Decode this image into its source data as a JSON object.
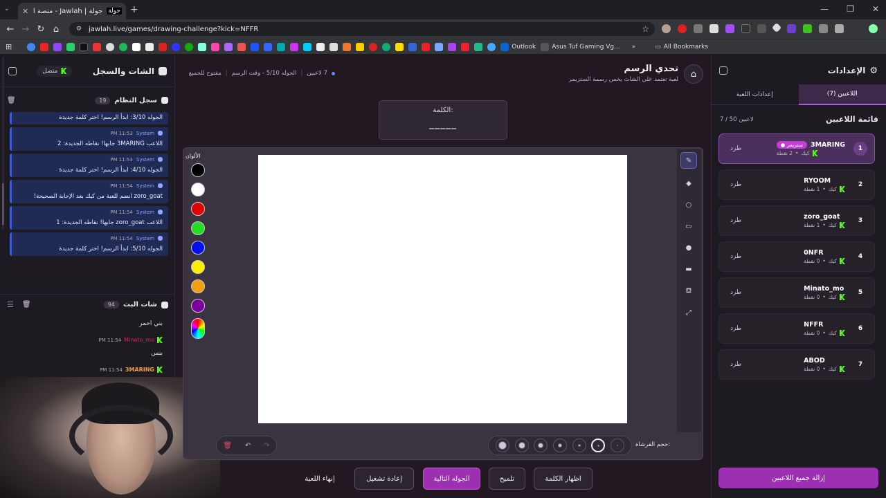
{
  "browser": {
    "tab_title": "جولة | Jawlah - منصة الألعاب ال...",
    "url": "jawlah.live/games/drawing-challenge?kick=NFFR",
    "bookmark_outlook": "Outlook",
    "bookmark_asus": "Asus Tuf Gaming Vg...",
    "bookmark_all": "All Bookmarks"
  },
  "left_panel": {
    "title": "الشات والسجل",
    "online_label": "متصل",
    "system_log": {
      "title": "سجل النظام",
      "count": "19",
      "messages": [
        {
          "sender": "",
          "time": "",
          "text": "الجوله 3/10: ابدأ الرسم! اختر كلمة جديدة"
        },
        {
          "sender": "System",
          "time": "11:53 PM",
          "text": "اللاعب 3MARING جابها! نقاطه الجديدة: 2"
        },
        {
          "sender": "System",
          "time": "11:53 PM",
          "text": "الجوله 4/10: ابدأ الرسم! اختر كلمة جديدة"
        },
        {
          "sender": "System",
          "time": "11:54 PM",
          "text": "zoro_goat انضم للعبة من كيك بعد الإجابة الصحيحة!"
        },
        {
          "sender": "System",
          "time": "11:54 PM",
          "text": "اللاعب zoro_goat جابها! نقاطه الجديدة: 1"
        },
        {
          "sender": "System",
          "time": "11:54 PM",
          "text": "الجوله 5/10: ابدأ الرسم! اختر كلمة جديدة"
        }
      ]
    },
    "stream_chat": {
      "title": "شات البث",
      "count": "94",
      "messages": [
        {
          "user": "",
          "time": "",
          "text": "بني احمر",
          "user_color": "#e8e8ee"
        },
        {
          "user": "Minato_mo",
          "time": "11:54 PM",
          "text": "بنس",
          "user_color": "#d4284f"
        },
        {
          "user": "3MARING",
          "time": "11:54 PM",
          "text": "",
          "user_color": "#f0a030"
        }
      ]
    }
  },
  "header": {
    "title": "تحدي الرسم",
    "subtitle": "لعبة تعتمد على الشات يخمن رسمة الستريمر",
    "players_count": "7 لاعبين",
    "round_info": "الجوله 5/10 - وقت الرسم",
    "open_label": "مفتوح للجميع"
  },
  "word": {
    "label": "الكلمة:",
    "blank": "_____"
  },
  "canvas_tools": {
    "colors_label": "الألوان",
    "colors": [
      "#000000",
      "#ffffff",
      "#e00000",
      "#22dd22",
      "#0010ee",
      "#ffee00",
      "#f0a010",
      "#7a0099"
    ],
    "tools": [
      "pencil-icon",
      "eraser-icon",
      "circle-icon",
      "rectangle-icon",
      "fill-circle-icon",
      "fill-rect-icon",
      "bucket-icon",
      "line-icon"
    ],
    "brush_label": "حجم الفرشاة:",
    "brush_sizes": [
      2,
      3,
      5,
      7,
      9,
      11,
      13
    ]
  },
  "actions": {
    "show_word": "اظهار الكلمة",
    "hint": "تلميح",
    "next_round": "الجوله التالية",
    "restart": "إعادة تشغيل",
    "end_game": "إنهاء اللعبة"
  },
  "right_panel": {
    "title": "الإعدادات",
    "tab_players": "اللاعبين (7)",
    "tab_game_settings": "إعدادات اللعبة",
    "list_title": "قائمة اللاعبين",
    "list_count": "7 / 50 لاعبين",
    "kick_label": "طرد",
    "platform": "كيك",
    "streamer_badge": "● ستريمر",
    "remove_all": "إزالة جميع اللاعبين",
    "players": [
      {
        "rank": "1",
        "name": "3MARING",
        "points": "2 نقطة"
      },
      {
        "rank": "2",
        "name": "RYOOM",
        "points": "1 نقطة"
      },
      {
        "rank": "3",
        "name": "zoro_goat",
        "points": "1 نقطة"
      },
      {
        "rank": "4",
        "name": "0NFR",
        "points": "0 نقطة"
      },
      {
        "rank": "5",
        "name": "Minato_mo",
        "points": "0 نقطة"
      },
      {
        "rank": "6",
        "name": "NFFR",
        "points": "0 نقطة"
      },
      {
        "rank": "7",
        "name": "ABOD",
        "points": "0 نقطة"
      }
    ]
  }
}
